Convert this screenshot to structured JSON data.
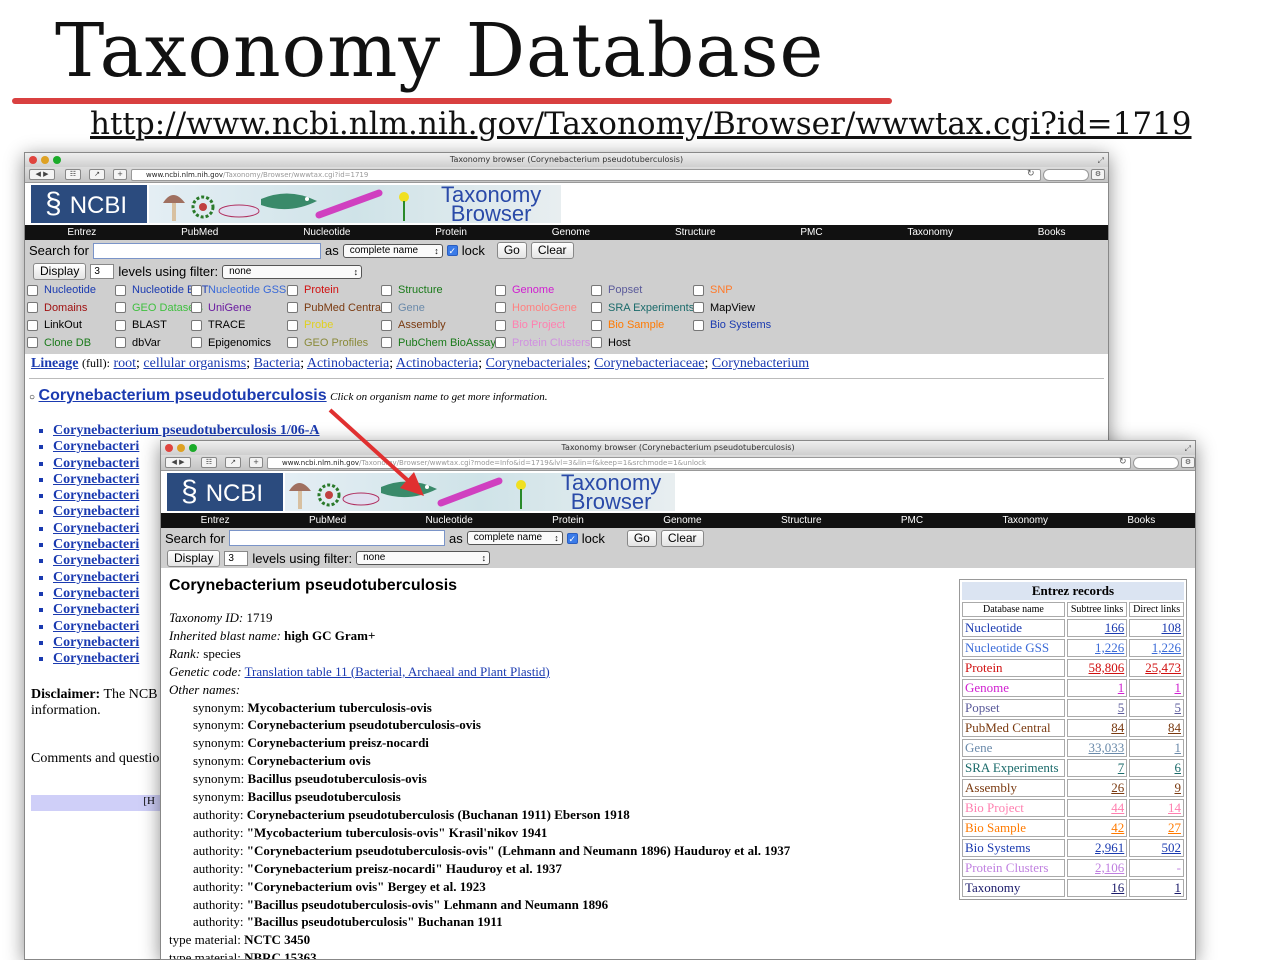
{
  "slide": {
    "title": "Taxonomy Database",
    "url": "http://www.ncbi.nlm.nih.gov/Taxonomy/Browser/wwwtax.cgi?id=1719"
  },
  "window_title": "Taxonomy browser (Corynebacterium pseudotuberculosis)",
  "back_window": {
    "address_host": "www.ncbi.nlm.nih.gov",
    "address_path": "/Taxonomy/Browser/wwwtax.cgi?id=1719"
  },
  "front_window": {
    "address_host": "www.ncbi.nlm.nih.gov",
    "address_path": "/Taxonomy/Browser/wwwtax.cgi?mode=Info&id=1719&lvl=3&lin=f&keep=1&srchmode=1&unlock"
  },
  "ncbi": {
    "logo_text": "NCBI",
    "browser_title_1": "Taxonomy",
    "browser_title_2": "Browser",
    "nav": [
      "Entrez",
      "PubMed",
      "Nucleotide",
      "Protein",
      "Genome",
      "Structure",
      "PMC",
      "Taxonomy",
      "Books"
    ]
  },
  "search": {
    "label": "Search for",
    "as_label": "as",
    "as_value": "complete name",
    "lock_label": "lock",
    "go_label": "Go",
    "clear_label": "Clear",
    "display_label": "Display",
    "levels_value": "3",
    "levels_label": "levels using filter:",
    "filter_value": "none"
  },
  "filters": [
    {
      "label": "Nucleotide",
      "color": "#1a3ab0"
    },
    {
      "label": "Nucleotide EST",
      "color": "#1a3ab0"
    },
    {
      "label": "Nucleotide GSS",
      "color": "#3a6ad8"
    },
    {
      "label": "Protein",
      "color": "#d01010"
    },
    {
      "label": "Structure",
      "color": "#1a7a1a"
    },
    {
      "label": "Genome",
      "color": "#d020d0"
    },
    {
      "label": "Popset",
      "color": "#5a5a9a"
    },
    {
      "label": "SNP",
      "color": "#ff7a2a"
    },
    {
      "label": "Domains",
      "color": "#a01010"
    },
    {
      "label": "GEO Datasets",
      "color": "#40c040"
    },
    {
      "label": "UniGene",
      "color": "#6a1aa0"
    },
    {
      "label": "PubMed Central",
      "color": "#7a3a10"
    },
    {
      "label": "Gene",
      "color": "#6a8aaa"
    },
    {
      "label": "HomoloGene",
      "color": "#ff8080"
    },
    {
      "label": "SRA Experiments",
      "color": "#1a6a6a"
    },
    {
      "label": "MapView",
      "color": "#000000"
    },
    {
      "label": "LinkOut",
      "color": "#000000"
    },
    {
      "label": "BLAST",
      "color": "#000000"
    },
    {
      "label": "TRACE",
      "color": "#000000"
    },
    {
      "label": "Probe",
      "color": "#e0d020"
    },
    {
      "label": "Assembly",
      "color": "#7a3a10"
    },
    {
      "label": "Bio Project",
      "color": "#ff80b0"
    },
    {
      "label": "Bio Sample",
      "color": "#ff7a00"
    },
    {
      "label": "Bio Systems",
      "color": "#1a3ab0"
    },
    {
      "label": "Clone DB",
      "color": "#1a7a1a"
    },
    {
      "label": "dbVar",
      "color": "#000000"
    },
    {
      "label": "Epigenomics",
      "color": "#000000"
    },
    {
      "label": "GEO Profiles",
      "color": "#8a8a3a"
    },
    {
      "label": "PubChem BioAssay",
      "color": "#1a7a1a"
    },
    {
      "label": "Protein Clusters",
      "color": "#d090e0"
    },
    {
      "label": "Host",
      "color": "#000000"
    }
  ],
  "lineage": {
    "label": "Lineage",
    "qualifier": "(full):",
    "items": [
      "root",
      "cellular organisms",
      "Bacteria",
      "Actinobacteria",
      "Actinobacteria",
      "Corynebacteriales",
      "Corynebacteriaceae",
      "Corynebacterium"
    ]
  },
  "back_content": {
    "organism": "Corynebacterium pseudotuberculosis",
    "hint": "Click on organism name to get more information.",
    "first_child": "Corynebacterium pseudotuberculosis 1/06-A",
    "truncated_child": "Corynebacteri",
    "disclaimer_label": "Disclaimer:",
    "disclaimer_text": "The NCB",
    "disclaimer_text2": "information.",
    "comments_text": "Comments and questio",
    "footer_fragment": "[H"
  },
  "organism_info": {
    "name": "Corynebacterium pseudotuberculosis",
    "taxonomy_id_label": "Taxonomy ID:",
    "taxonomy_id": "1719",
    "blast_label": "Inherited blast name:",
    "blast_name": "high GC Gram+",
    "rank_label": "Rank:",
    "rank": "species",
    "genetic_code_label": "Genetic code:",
    "genetic_code": "Translation table 11 (Bacterial, Archaeal and Plant Plastid)",
    "other_names_label": "Other names:",
    "other_names": [
      {
        "kind": "synonym:",
        "name": "Mycobacterium tuberculosis-ovis"
      },
      {
        "kind": "synonym:",
        "name": "Corynebacterium pseudotuberculosis-ovis"
      },
      {
        "kind": "synonym:",
        "name": "Corynebacterium preisz-nocardi"
      },
      {
        "kind": "synonym:",
        "name": "Corynebacterium ovis"
      },
      {
        "kind": "synonym:",
        "name": "Bacillus pseudotuberculosis-ovis"
      },
      {
        "kind": "synonym:",
        "name": "Bacillus pseudotuberculosis"
      },
      {
        "kind": "authority:",
        "name": "Corynebacterium pseudotuberculosis (Buchanan 1911) Eberson 1918"
      },
      {
        "kind": "authority:",
        "name": "\"Mycobacterium tuberculosis-ovis\" Krasil'nikov 1941"
      },
      {
        "kind": "authority:",
        "name": "\"Corynebacterium pseudotuberculosis-ovis\" (Lehmann and Neumann 1896) Hauduroy et al. 1937"
      },
      {
        "kind": "authority:",
        "name": "\"Corynebacterium preisz-nocardi\" Hauduroy et al. 1937"
      },
      {
        "kind": "authority:",
        "name": "\"Corynebacterium ovis\" Bergey et al. 1923"
      },
      {
        "kind": "authority:",
        "name": "\"Bacillus pseudotuberculosis-ovis\" Lehmann and Neumann 1896"
      },
      {
        "kind": "authority:",
        "name": "\"Bacillus pseudotuberculosis\" Buchanan 1911"
      }
    ],
    "type_material": [
      {
        "kind": "type material:",
        "name": "NCTC 3450"
      },
      {
        "kind": "type material:",
        "name": "NBRC 15363"
      }
    ]
  },
  "entrez_records": {
    "title": "Entrez records",
    "columns": [
      "Database name",
      "Subtree links",
      "Direct links"
    ],
    "rows": [
      {
        "name": "Nucleotide",
        "subtree": "166",
        "direct": "108",
        "color": "#1a3ab0"
      },
      {
        "name": "Nucleotide GSS",
        "subtree": "1,226",
        "direct": "1,226",
        "color": "#3a6ad8"
      },
      {
        "name": "Protein",
        "subtree": "58,806",
        "direct": "25,473",
        "color": "#d01010"
      },
      {
        "name": "Genome",
        "subtree": "1",
        "direct": "1",
        "color": "#d020d0"
      },
      {
        "name": "Popset",
        "subtree": "5",
        "direct": "5",
        "color": "#5a5a9a"
      },
      {
        "name": "PubMed Central",
        "subtree": "84",
        "direct": "84",
        "color": "#7a3a10"
      },
      {
        "name": "Gene",
        "subtree": "33,033",
        "direct": "1",
        "color": "#6a8aaa"
      },
      {
        "name": "SRA Experiments",
        "subtree": "7",
        "direct": "6",
        "color": "#1a6a6a"
      },
      {
        "name": "Assembly",
        "subtree": "26",
        "direct": "9",
        "color": "#7a3a10"
      },
      {
        "name": "Bio Project",
        "subtree": "44",
        "direct": "14",
        "color": "#ff80b0"
      },
      {
        "name": "Bio Sample",
        "subtree": "42",
        "direct": "27",
        "color": "#ff7a00"
      },
      {
        "name": "Bio Systems",
        "subtree": "2,961",
        "direct": "502",
        "color": "#1a3ab0"
      },
      {
        "name": "Protein Clusters",
        "subtree": "2,106",
        "direct": "-",
        "color": "#c080e0"
      },
      {
        "name": "Taxonomy",
        "subtree": "16",
        "direct": "1",
        "color": "#1a1a6a"
      }
    ]
  }
}
